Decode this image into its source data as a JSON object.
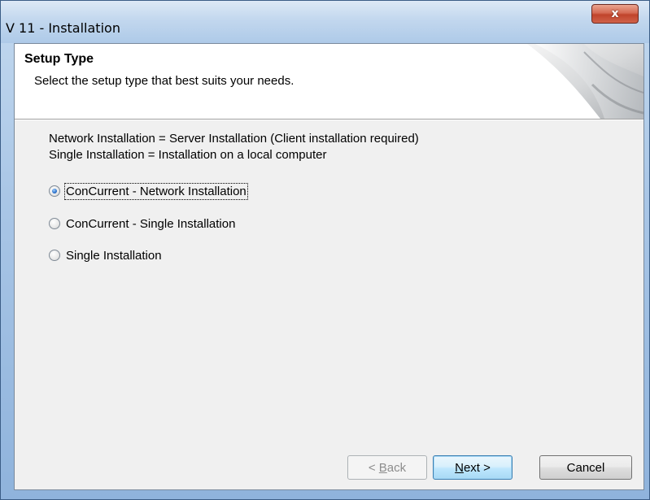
{
  "window": {
    "title": "V 11 - Installation",
    "close_label": "x"
  },
  "header": {
    "title": "Setup Type",
    "subtitle": "Select the setup type that best suits your needs."
  },
  "description": {
    "line1": "Network Installation = Server Installation (Client installation required)",
    "line2": "Single Installation = Installation on a local computer"
  },
  "options": [
    {
      "label": "ConCurrent - Network Installation",
      "selected": true
    },
    {
      "label": "ConCurrent - Single Installation",
      "selected": false
    },
    {
      "label": "Single Installation",
      "selected": false
    }
  ],
  "buttons": {
    "back": {
      "prefix": "< ",
      "mnemonic": "B",
      "rest": "ack",
      "enabled": false
    },
    "next": {
      "mnemonic": "N",
      "rest": "ext >",
      "enabled": true
    },
    "cancel": {
      "label": "Cancel",
      "enabled": true
    }
  },
  "colors": {
    "accent": "#3c7fb1",
    "dialog_bg": "#f0f0f0",
    "close_button": "#c0442c"
  }
}
